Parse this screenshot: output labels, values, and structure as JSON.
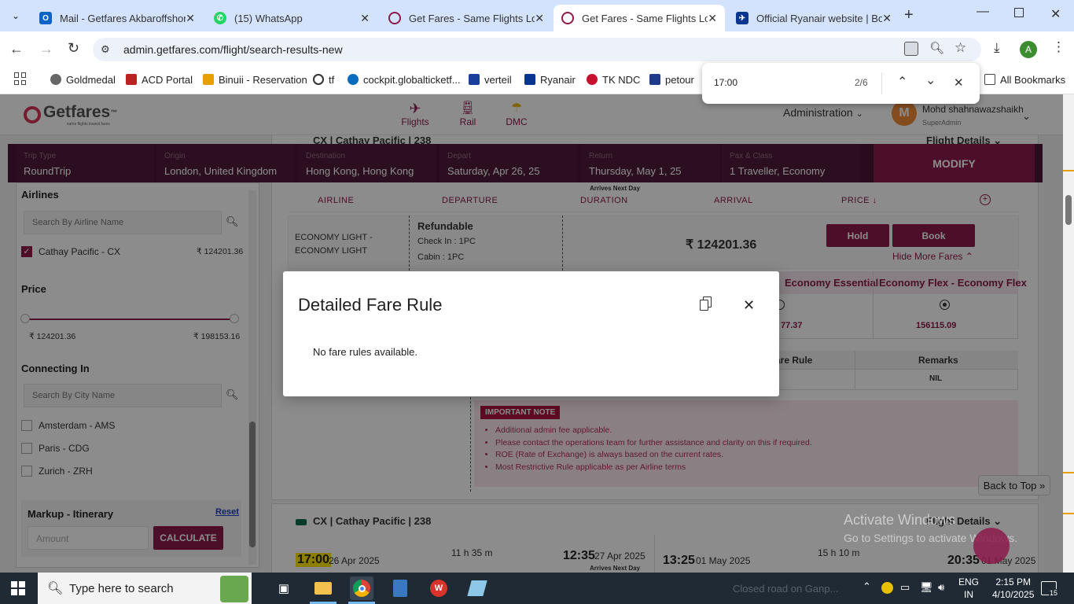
{
  "browser": {
    "tabs": [
      {
        "title": "Mail - Getfares Akbaroffshor"
      },
      {
        "title": "(15) WhatsApp"
      },
      {
        "title": "Get Fares - Same Flights Low"
      },
      {
        "title": "Get Fares - Same Flights Low"
      },
      {
        "title": "Official Ryanair website | Boo"
      }
    ],
    "url": "admin.getfares.com/flight/search-results-new",
    "bookmarks": [
      "Goldmedal",
      "ACD Portal",
      "Binuii - Reservation",
      "tf",
      "cockpit.globalticketf...",
      "verteil",
      "Ryanair",
      "TK NDC",
      "petour"
    ],
    "all_bookmarks": "All Bookmarks",
    "find": {
      "query": "17:00",
      "count": "2/6"
    },
    "profile_initial": "A"
  },
  "header": {
    "logo": "Getfares",
    "logo_tm": "™",
    "logo_tag": "same flights lowest fares",
    "nav": [
      {
        "label": "Flights",
        "icon": "plane-icon"
      },
      {
        "label": "Rail",
        "icon": "train-icon"
      },
      {
        "label": "DMC",
        "icon": "umbrella-icon"
      }
    ],
    "admin_label": "Administration",
    "user_initial": "M",
    "user_name": "Mohd shahnawazshaikh",
    "user_role": "SuperAdmin"
  },
  "search": {
    "fields": [
      {
        "label": "Trip Type",
        "value": "RoundTrip"
      },
      {
        "label": "Origin",
        "value": "London, United Kingdom"
      },
      {
        "label": "Destination",
        "value": "Hong Kong, Hong Kong"
      },
      {
        "label": "Depart",
        "value": "Saturday, Apr 26, 25"
      },
      {
        "label": "Return",
        "value": "Thursday, May 1, 25"
      },
      {
        "label": "Pax & Class",
        "value": "1 Traveller, Economy"
      }
    ],
    "modify_label": "MODIFY"
  },
  "sidebar": {
    "airlines_title": "Airlines",
    "airline_search_placeholder": "Search By Airline Name",
    "airline_item": {
      "name": "Cathay Pacific - CX",
      "price": "₹ 124201.36"
    },
    "price_title": "Price",
    "price_min": "₹ 124201.36",
    "price_max": "₹ 198153.16",
    "connecting_title": "Connecting In",
    "city_search_placeholder": "Search By City Name",
    "cities": [
      "Amsterdam - AMS",
      "Paris - CDG",
      "Zurich - ZRH"
    ],
    "markup_title": "Markup - Itinerary",
    "reset_label": "Reset",
    "amount_placeholder": "Amount",
    "calculate_label": "CALCULATE"
  },
  "results": {
    "card_title": "CX | Cathay Pacific | 238",
    "flight_details": "Flight Details",
    "arrives_next_day": "Arrives Next Day",
    "columns": [
      "AIRLINE",
      "DEPARTURE",
      "DURATION",
      "ARRIVAL",
      "PRICE"
    ],
    "fare_name": "ECONOMY LIGHT - ECONOMY LIGHT",
    "refundable": "Refundable",
    "check_in": "Check In : 1PC",
    "cabin": "Cabin : 1PC",
    "price": "₹ 124201.36",
    "hold_label": "Hold",
    "book_label": "Book",
    "hide_more": "Hide More Fares",
    "fare_cols": [
      "Economy Essential",
      "Economy Flex - Economy Flex"
    ],
    "fare_prices": [
      "77.37",
      "156115.09"
    ],
    "rule_header": "are Rule",
    "remarks_header": "Remarks",
    "remarks_value": "NIL",
    "important_note": "IMPORTANT NOTE",
    "notes": [
      "Additional admin fee applicable.",
      "Please contact the operations team for further assistance and clarity on this if required.",
      "ROE (Rate of Exchange) is always based on the current rates.",
      "Most Restrictive Rule applicable as per Airline terms"
    ],
    "back_to_top": "Back to Top",
    "card2": {
      "title": "CX | Cathay Pacific | 238",
      "flight_details": "Flight Details",
      "dep_time": "17:00",
      "dep_date": "26 Apr 2025",
      "duration": "11 h 35 m",
      "arr_time": "12:35",
      "arr_date": "27 Apr 2025",
      "arrives": "Arrives Next Day",
      "ret_dep_time": "13:25",
      "ret_dep_date": "01 May 2025",
      "ret_duration": "15 h 10 m",
      "ret_arr_time": "20:35",
      "ret_arr_date": "01 May 2025"
    }
  },
  "modal": {
    "title": "Detailed Fare Rule",
    "body": "No fare rules available."
  },
  "watermark": {
    "line1": "Activate Windows",
    "line2": "Go to Settings to activate Windows."
  },
  "taskbar": {
    "search_placeholder": "Type here to search",
    "weather": "Closed road on Ganp...",
    "lang1": "ENG",
    "lang2": "IN",
    "time": "2:15 PM",
    "date": "4/10/2025",
    "notif": "15"
  }
}
